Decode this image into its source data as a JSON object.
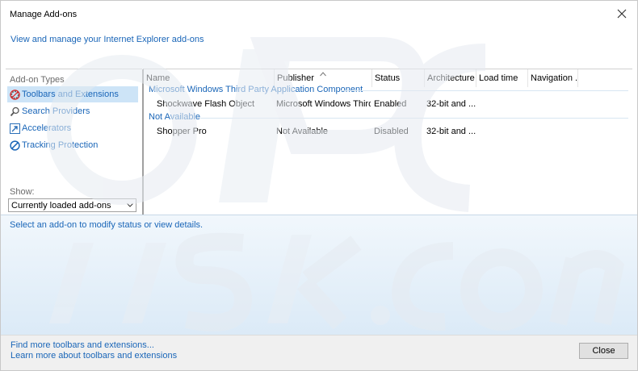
{
  "window": {
    "title": "Manage Add-ons"
  },
  "header": {
    "link": "View and manage your Internet Explorer add-ons"
  },
  "left": {
    "types_label": "Add-on Types",
    "items": [
      {
        "label": "Toolbars and Extensions",
        "icon": "gear-block-icon",
        "selected": true
      },
      {
        "label": "Search Providers",
        "icon": "search-icon"
      },
      {
        "label": "Accelerators",
        "icon": "accelerator-icon"
      },
      {
        "label": "Tracking Protection",
        "icon": "no-entry-icon"
      }
    ],
    "show_label": "Show:",
    "show_value": "Currently loaded add-ons"
  },
  "table": {
    "columns": [
      "Name",
      "Publisher",
      "Status",
      "Architecture",
      "Load time",
      "Navigation ..."
    ],
    "groups": [
      {
        "title": "Microsoft Windows Third Party Application Component",
        "rows": [
          {
            "name": "Shockwave Flash Object",
            "publisher": "Microsoft Windows Third...",
            "status": "Enabled",
            "architecture": "32-bit and ..."
          }
        ]
      },
      {
        "title": "Not Available",
        "rows": [
          {
            "name": "Shopper Pro",
            "publisher": "Not Available",
            "status": "Disabled",
            "architecture": "32-bit and ..."
          }
        ]
      }
    ]
  },
  "details": {
    "hint": "Select an add-on to modify status or view details."
  },
  "footer": {
    "link1": "Find more toolbars and extensions...",
    "link2": "Learn more about toolbars and extensions",
    "close_label": "Close"
  },
  "colors": {
    "link": "#1a66b8",
    "selection": "#cde4f7",
    "details_bg": "#dbeaf7"
  }
}
